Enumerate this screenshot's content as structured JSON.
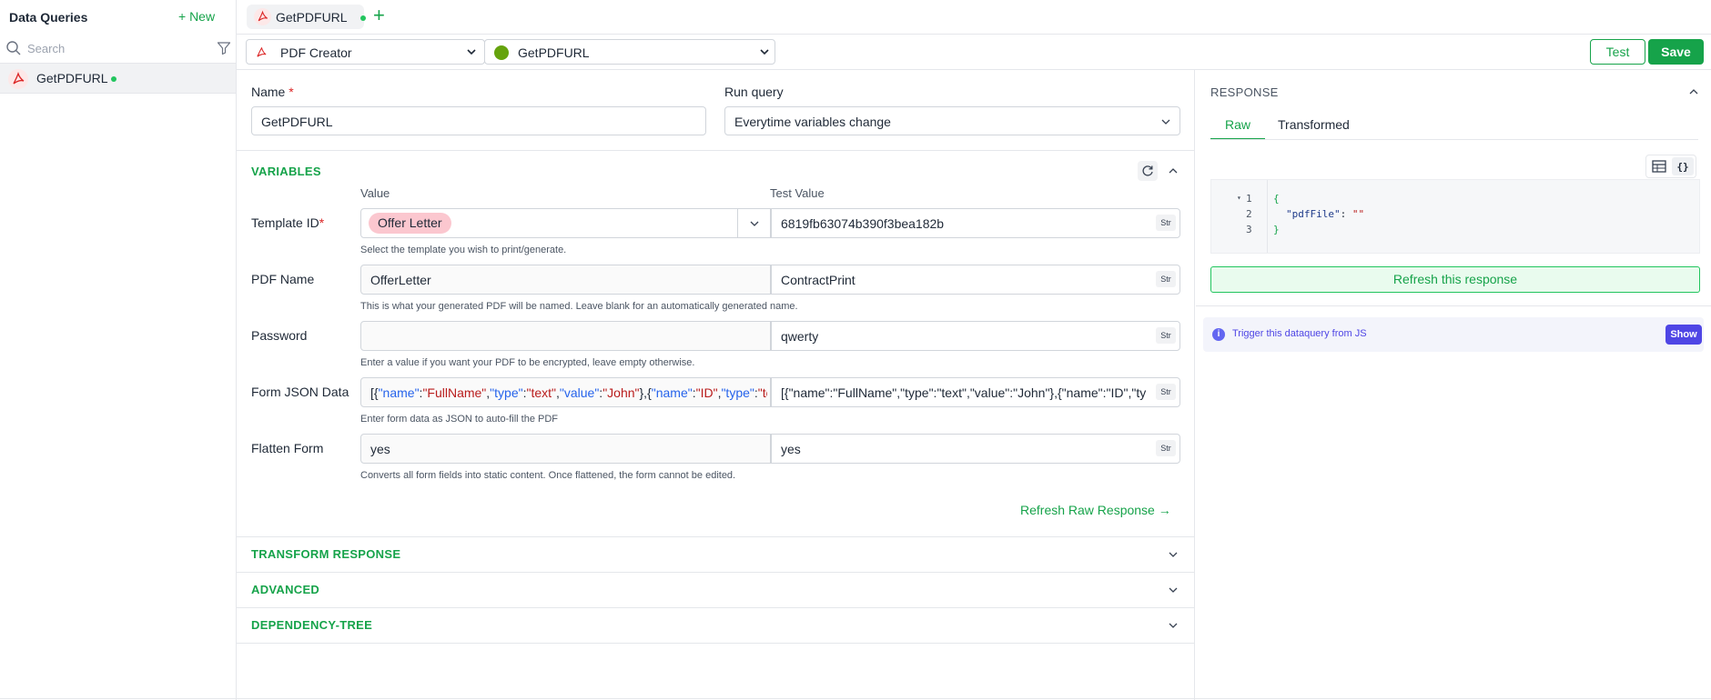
{
  "sidebar": {
    "title": "Data Queries",
    "new_label": "+ New",
    "search_placeholder": "Search",
    "items": [
      {
        "label": "GetPDFURL"
      }
    ]
  },
  "tabs": [
    {
      "label": "GetPDFURL"
    }
  ],
  "toolbar": {
    "datasource": "PDF Creator",
    "query": "GetPDFURL",
    "test_label": "Test",
    "save_label": "Save"
  },
  "form": {
    "name_label": "Name",
    "name_value": "GetPDFURL",
    "run_query_label": "Run query",
    "run_query_value": "Everytime variables change"
  },
  "variables": {
    "title": "VARIABLES",
    "value_header": "Value",
    "test_value_header": "Test Value",
    "type_badge": "Str",
    "rows": [
      {
        "label": "Template ID",
        "value": "Offer Letter",
        "test_value": "6819fb63074b390f3bea182b",
        "hint": "Select the template you wish to print/generate."
      },
      {
        "label": "PDF Name",
        "value": "OfferLetter",
        "test_value": "ContractPrint",
        "hint": "This is what your generated PDF will be named. Leave blank for an automatically generated name."
      },
      {
        "label": "Password",
        "value": "",
        "test_value": "qwerty",
        "hint": "Enter a value if you want your PDF to be encrypted, leave empty otherwise."
      },
      {
        "label": "Form JSON Data",
        "value_prefix": "[{",
        "value_parts": [
          {
            "t": "\"name\"",
            "c": "#2563eb"
          },
          {
            "t": ":",
            "c": "#1f2937"
          },
          {
            "t": "\"FullName\"",
            "c": "#b91c1c"
          },
          {
            "t": ",",
            "c": "#1f2937"
          },
          {
            "t": "\"type\"",
            "c": "#2563eb"
          },
          {
            "t": ":",
            "c": "#1f2937"
          },
          {
            "t": "\"text\"",
            "c": "#b91c1c"
          },
          {
            "t": ",",
            "c": "#1f2937"
          },
          {
            "t": "\"value\"",
            "c": "#2563eb"
          },
          {
            "t": ":",
            "c": "#1f2937"
          },
          {
            "t": "\"John\"",
            "c": "#b91c1c"
          },
          {
            "t": "},{",
            "c": "#1f2937"
          },
          {
            "t": "\"name\"",
            "c": "#2563eb"
          },
          {
            "t": ":",
            "c": "#1f2937"
          },
          {
            "t": "\"ID\"",
            "c": "#b91c1c"
          },
          {
            "t": ",",
            "c": "#1f2937"
          },
          {
            "t": "\"type\"",
            "c": "#2563eb"
          },
          {
            "t": ":",
            "c": "#1f2937"
          },
          {
            "t": "\"tex",
            "c": "#b91c1c"
          }
        ],
        "test_value": "[{\"name\":\"FullName\",\"type\":\"text\",\"value\":\"John\"},{\"name\":\"ID\",\"type\":\"tex",
        "hint": "Enter form data as JSON to auto-fill the PDF"
      },
      {
        "label": "Flatten Form",
        "value": "yes",
        "test_value": "yes",
        "hint": "Converts all form fields into static content. Once flattened, the form cannot be edited."
      }
    ],
    "refresh_raw_label": "Refresh Raw Response →"
  },
  "sections": [
    {
      "title": "TRANSFORM RESPONSE"
    },
    {
      "title": "ADVANCED"
    },
    {
      "title": "DEPENDENCY-TREE"
    }
  ],
  "response": {
    "title": "RESPONSE",
    "tab_raw": "Raw",
    "tab_transformed": "Transformed",
    "code_lines": [
      "{",
      "\"pdfFile\"",
      ": ",
      "\"\"",
      "}"
    ],
    "line_numbers": [
      "1",
      "2",
      "3"
    ],
    "refresh_label": "Refresh this response",
    "trigger_text": "Trigger this dataquery from JS",
    "show_label": "Show"
  },
  "colors": {
    "accent": "#16a34a",
    "indigo": "#4f46e5",
    "required": "#dc2626"
  }
}
